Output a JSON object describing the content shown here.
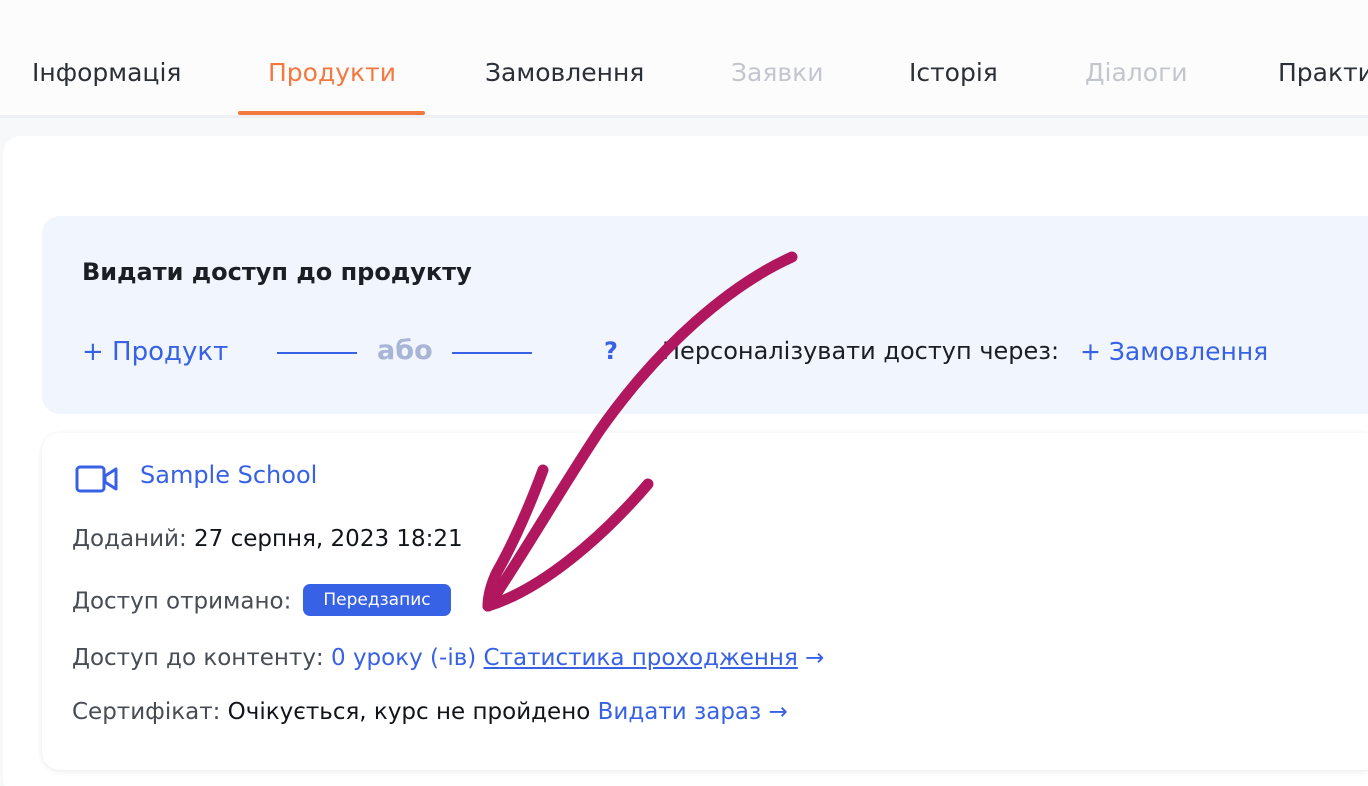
{
  "tabs": [
    {
      "label": "Інформація",
      "state": "normal"
    },
    {
      "label": "Продукти",
      "state": "active"
    },
    {
      "label": "Замовлення",
      "state": "normal"
    },
    {
      "label": "Заявки",
      "state": "disabled"
    },
    {
      "label": "Історія",
      "state": "normal"
    },
    {
      "label": "Діалоги",
      "state": "disabled"
    },
    {
      "label": "Практи",
      "state": "normal"
    }
  ],
  "grant": {
    "title": "Видати доступ до продукту",
    "add_product": "+ Продукт",
    "or": "або",
    "help": "?",
    "personalize": "Персоналізувати доступ через:",
    "add_order": "+ Замовлення"
  },
  "product": {
    "icon": "video-camera-icon",
    "name": "Sample School",
    "added_label": "Доданий:",
    "added_value": "27 серпня, 2023 18:21",
    "access_label": "Доступ отримано:",
    "access_badge": "Передзапис",
    "content_label": "Доступ до контенту:",
    "content_value": "0 уроку (-ів)",
    "stats_link": "Статистика проходження",
    "stats_arrow": "→",
    "cert_label": "Сертифікат:",
    "cert_value": "Очікується, курс не пройдено",
    "cert_link": "Видати зараз",
    "cert_arrow": "→"
  },
  "colors": {
    "accent": "#f4793e",
    "link": "#3862e6",
    "annotation": "#b0175f"
  }
}
